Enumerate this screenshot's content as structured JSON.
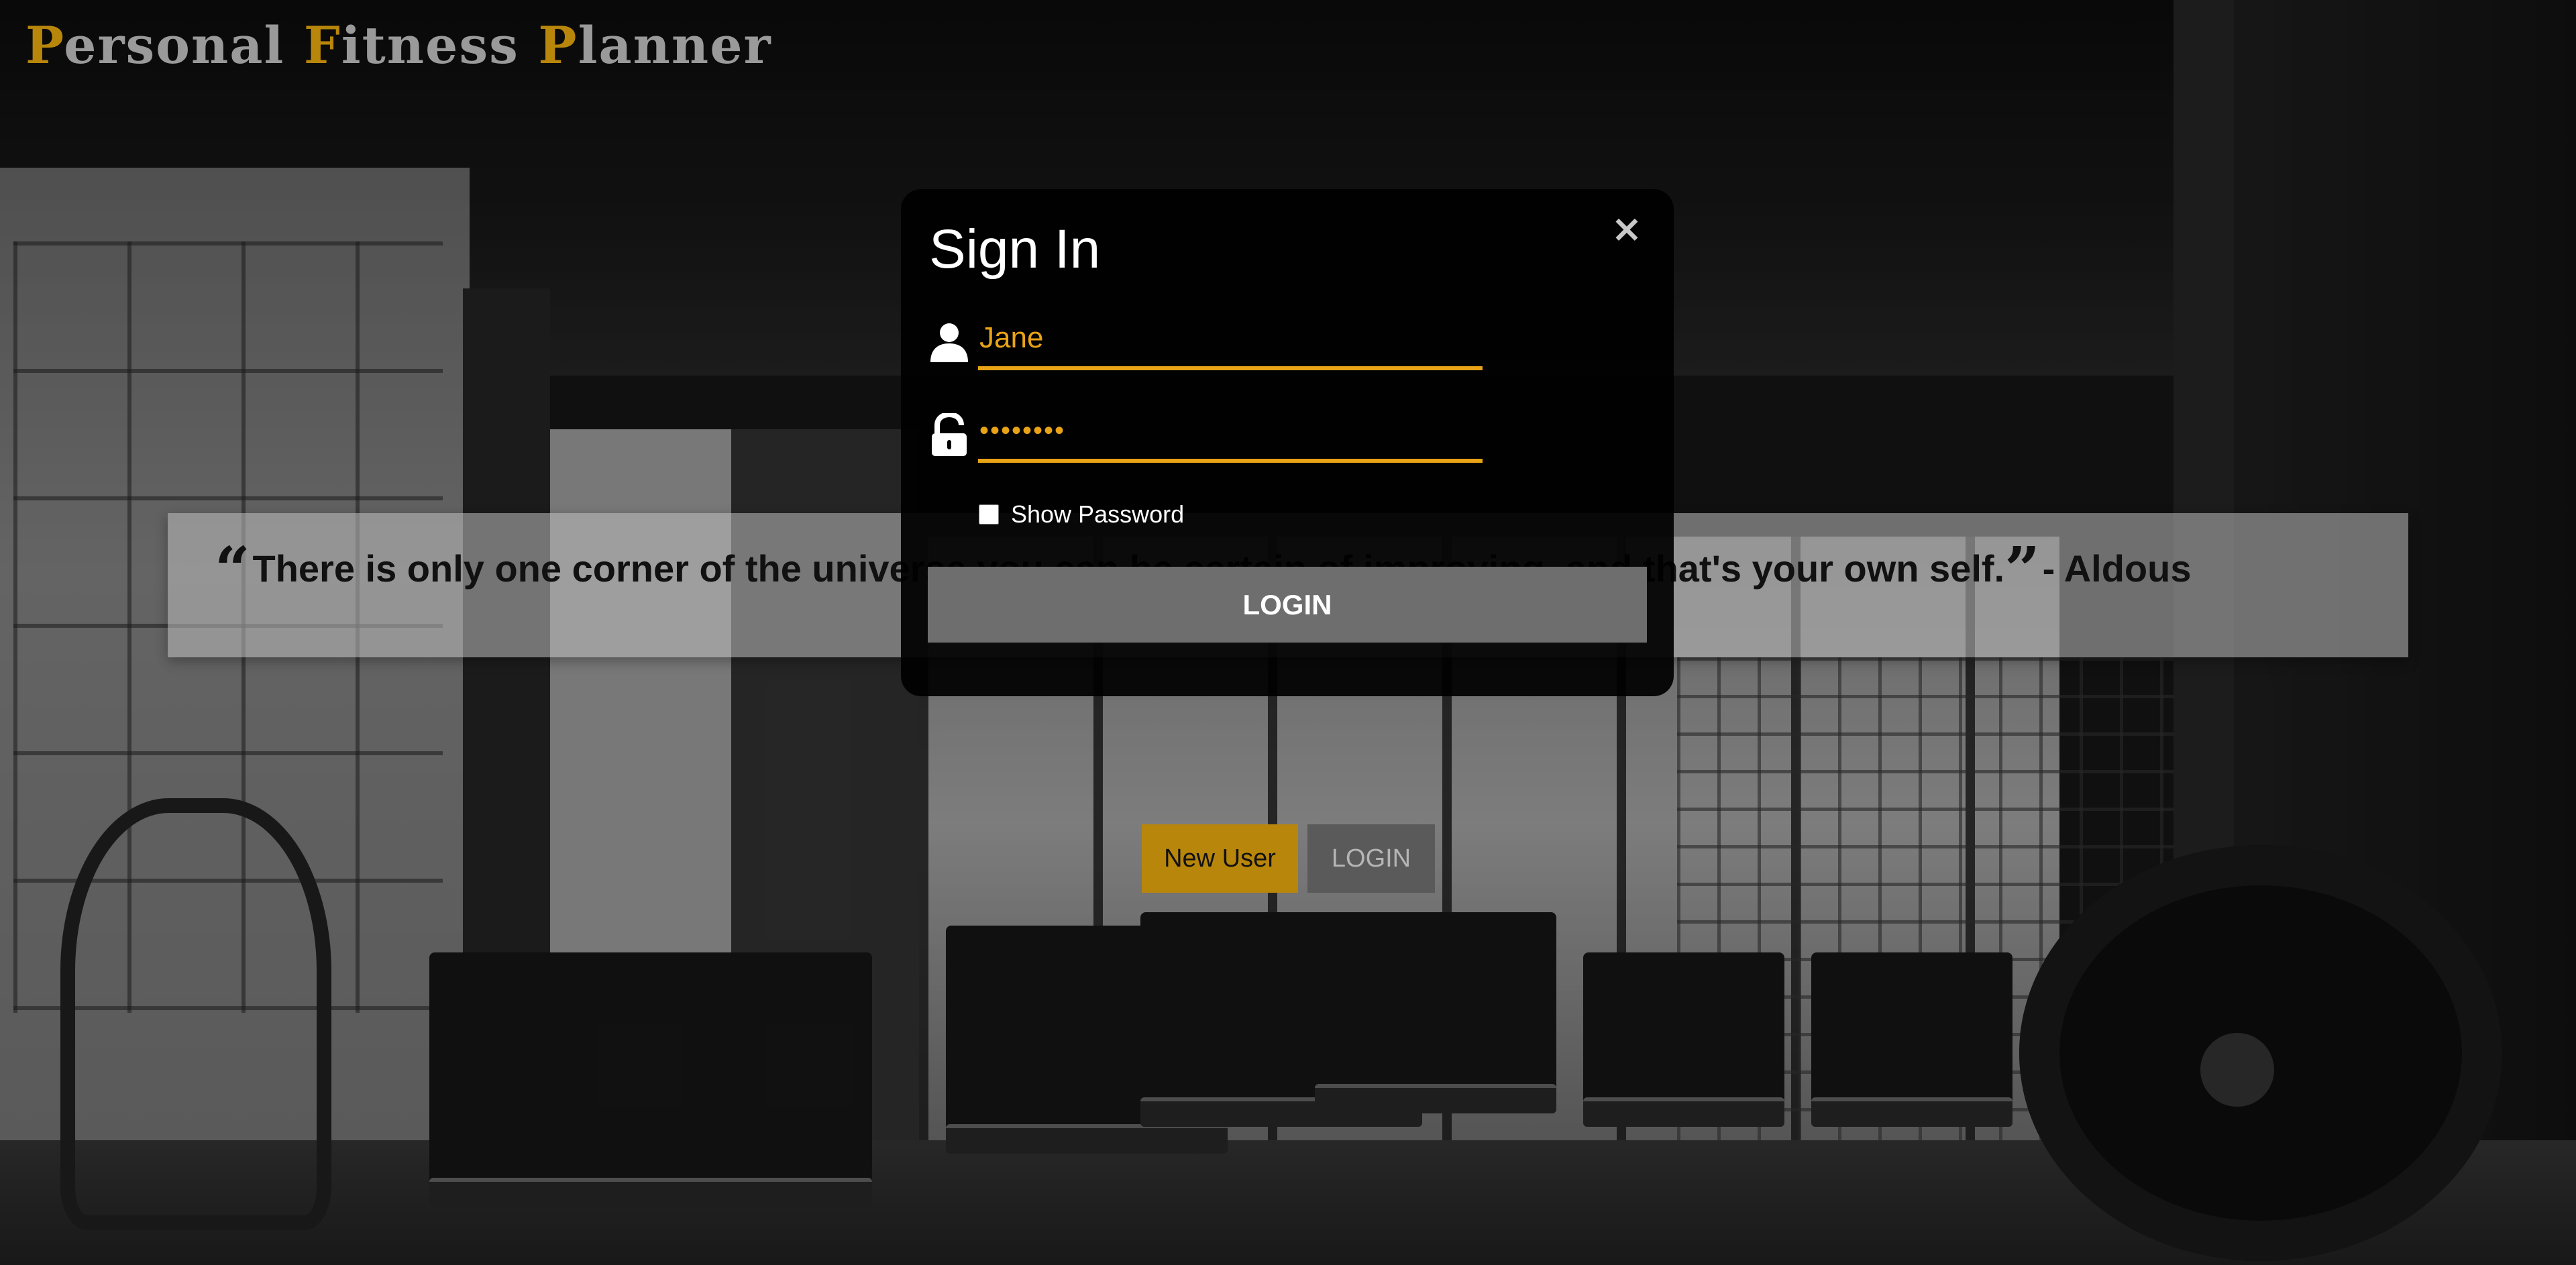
{
  "app": {
    "title_parts": [
      {
        "cap": "P",
        "rest": "ersonal "
      },
      {
        "cap": "F",
        "rest": "itness "
      },
      {
        "cap": "P",
        "rest": "lanner"
      }
    ]
  },
  "quote": {
    "open_mark": "“",
    "text": "There is only one corner of the universe you can be certain of improving, and that's your own self.",
    "close_mark": "”",
    "author": " - Aldous"
  },
  "signin": {
    "title": "Sign In",
    "close_label": "×",
    "username": {
      "value": "Jane",
      "icon": "user-icon"
    },
    "password": {
      "value": "••••••••",
      "icon": "unlocked-padlock-icon"
    },
    "show_password_label": "Show Password",
    "show_password_checked": false,
    "login_label": "LOGIN"
  },
  "actions": {
    "new_user_label": "New User",
    "login_label": "LOGIN"
  },
  "colors": {
    "accent_gold": "#b8860b",
    "input_orange": "#e8a317",
    "modal_bg": "#000000",
    "login_button_gray": "#6e6e6e"
  }
}
